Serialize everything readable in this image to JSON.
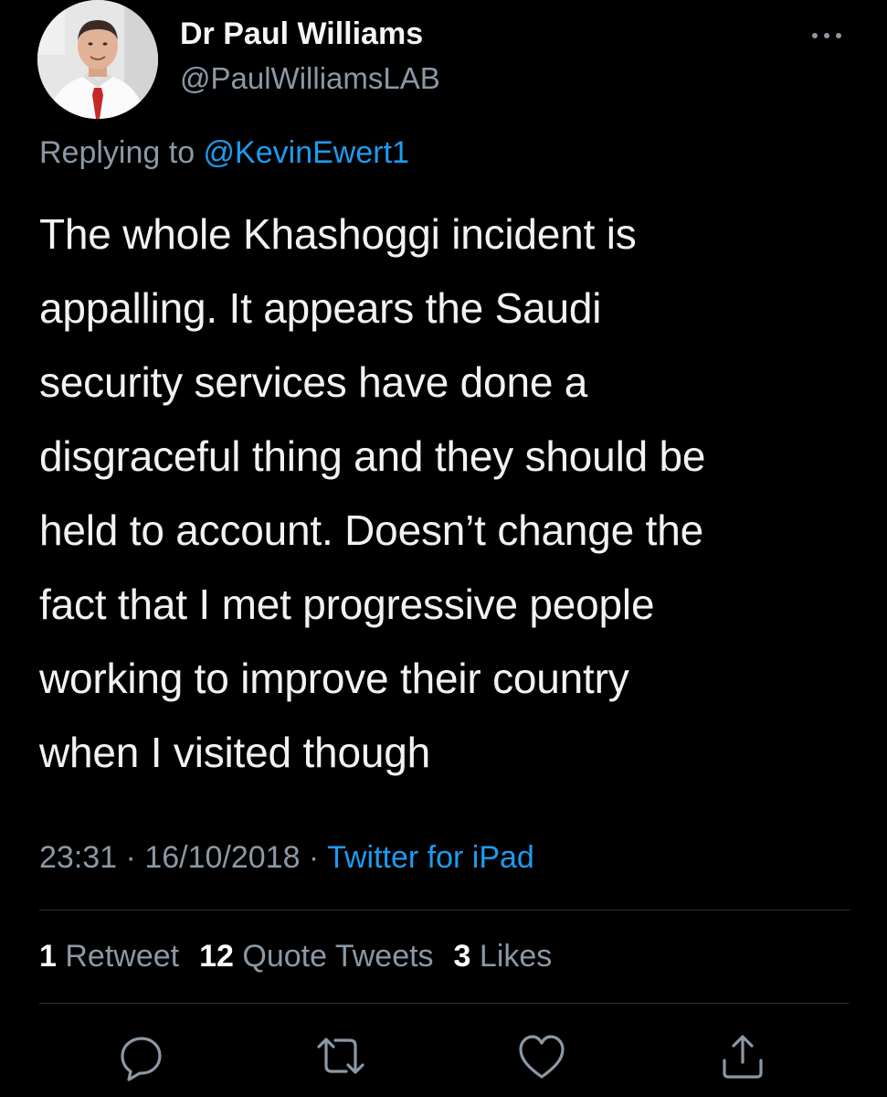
{
  "author": {
    "display_name": "Dr Paul Williams",
    "handle": "@PaulWilliamsLAB"
  },
  "reply": {
    "prefix": "Replying to ",
    "mention": "@KevinEwert1"
  },
  "tweet": {
    "lines": [
      "The whole Khashoggi incident is",
      "appalling. It appears the Saudi",
      "security services have done a",
      "disgraceful thing and they should be",
      "held to account. Doesn’t change the",
      "fact that I met progressive people",
      "working to improve their country",
      "when I visited though"
    ]
  },
  "meta": {
    "time": "23:31",
    "separator1": " · ",
    "date": "16/10/2018",
    "separator2": " · ",
    "source": "Twitter for iPad"
  },
  "stats": {
    "retweets_count": "1",
    "retweets_label": " Retweet",
    "quotes_count": "12",
    "quotes_label": " Quote Tweets",
    "likes_count": "3",
    "likes_label": " Likes"
  },
  "icons": {
    "more": "more-horizontal-icon",
    "reply": "reply-icon",
    "retweet": "retweet-icon",
    "like": "heart-icon",
    "share": "share-icon"
  },
  "colors": {
    "background": "#000000",
    "text": "#f2f2f2",
    "secondary": "#8b98a5",
    "link": "#1d9bf0",
    "divider": "#2f3336"
  }
}
